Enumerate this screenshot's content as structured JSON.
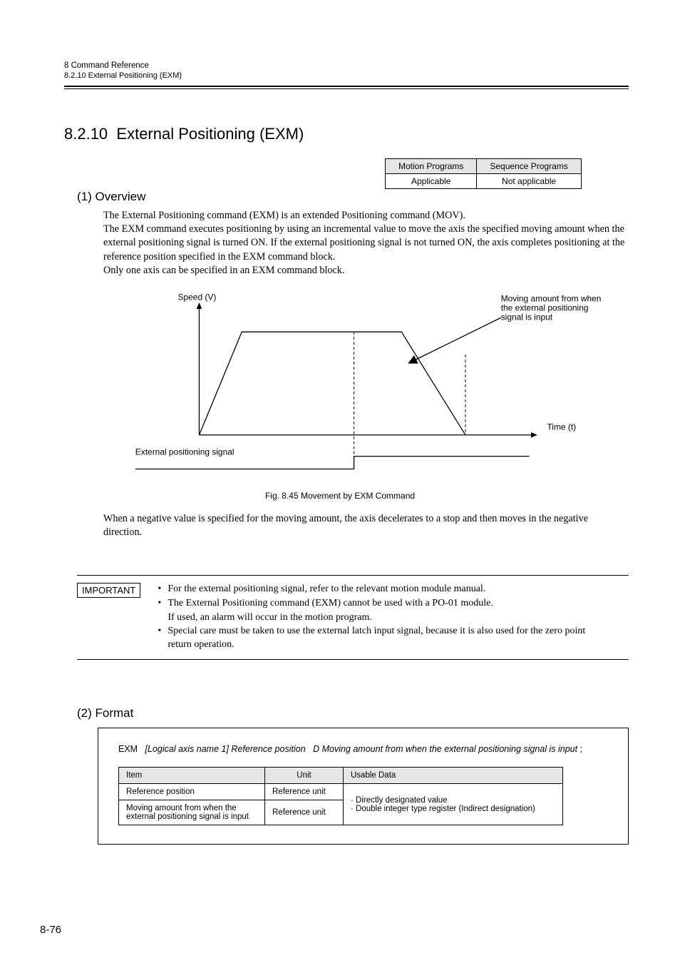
{
  "header": {
    "chapter": "8  Command Reference",
    "sub": "8.2.10  External Positioning (EXM)"
  },
  "section": {
    "number": "8.2.10",
    "title": "External Positioning (EXM)"
  },
  "applicability": {
    "col1": "Motion Programs",
    "col2": "Sequence Programs",
    "v1": "Applicable",
    "v2": "Not applicable"
  },
  "overview": {
    "heading": "(1) Overview",
    "para": "The External Positioning command (EXM) is an extended Positioning command (MOV).\nThe EXM command executes positioning by using an incremental value to move the axis the specified moving amount when the external positioning signal is turned ON. If the external positioning signal is not turned ON, the axis completes positioning at the reference position specified in the EXM command block.\nOnly one axis can be specified in an EXM command block."
  },
  "diagram": {
    "speed": "Speed (V)",
    "moving_note": "Moving amount from when the external positioning signal is input",
    "time": "Time (t)",
    "ext_signal": "External positioning signal"
  },
  "figure_caption": "Fig. 8.45  Movement by EXM Command",
  "para2": "When a negative value is specified for the moving amount, the axis decelerates to a stop and then moves in the negative direction.",
  "important": {
    "label": "IMPORTANT",
    "b1": "For the external positioning signal, refer to the relevant motion module manual.",
    "b2": "The External Positioning command (EXM) cannot be used with a PO-01 module.",
    "b2sub": "If used, an alarm will occur in the motion program.",
    "b3": "Special care must be taken to use the external latch input signal, because it is also used for the zero point return operation."
  },
  "format": {
    "heading": "(2) Format",
    "cmd": "EXM",
    "axis_seg": "[Logical axis name 1] Reference position",
    "d_seg": "D Moving amount from when the external positioning signal is input",
    "semicolon": " ;",
    "th_item": "Item",
    "th_unit": "Unit",
    "th_data": "Usable Data",
    "r1_item": "Reference position",
    "r1_unit": "Reference unit",
    "r2_item": "Moving amount from when the external positioning signal is input",
    "r2_unit": "Reference unit",
    "data_l1": "· Directly designated value",
    "data_l2": "· Double integer type register (Indirect designation)"
  },
  "page": "8-76"
}
